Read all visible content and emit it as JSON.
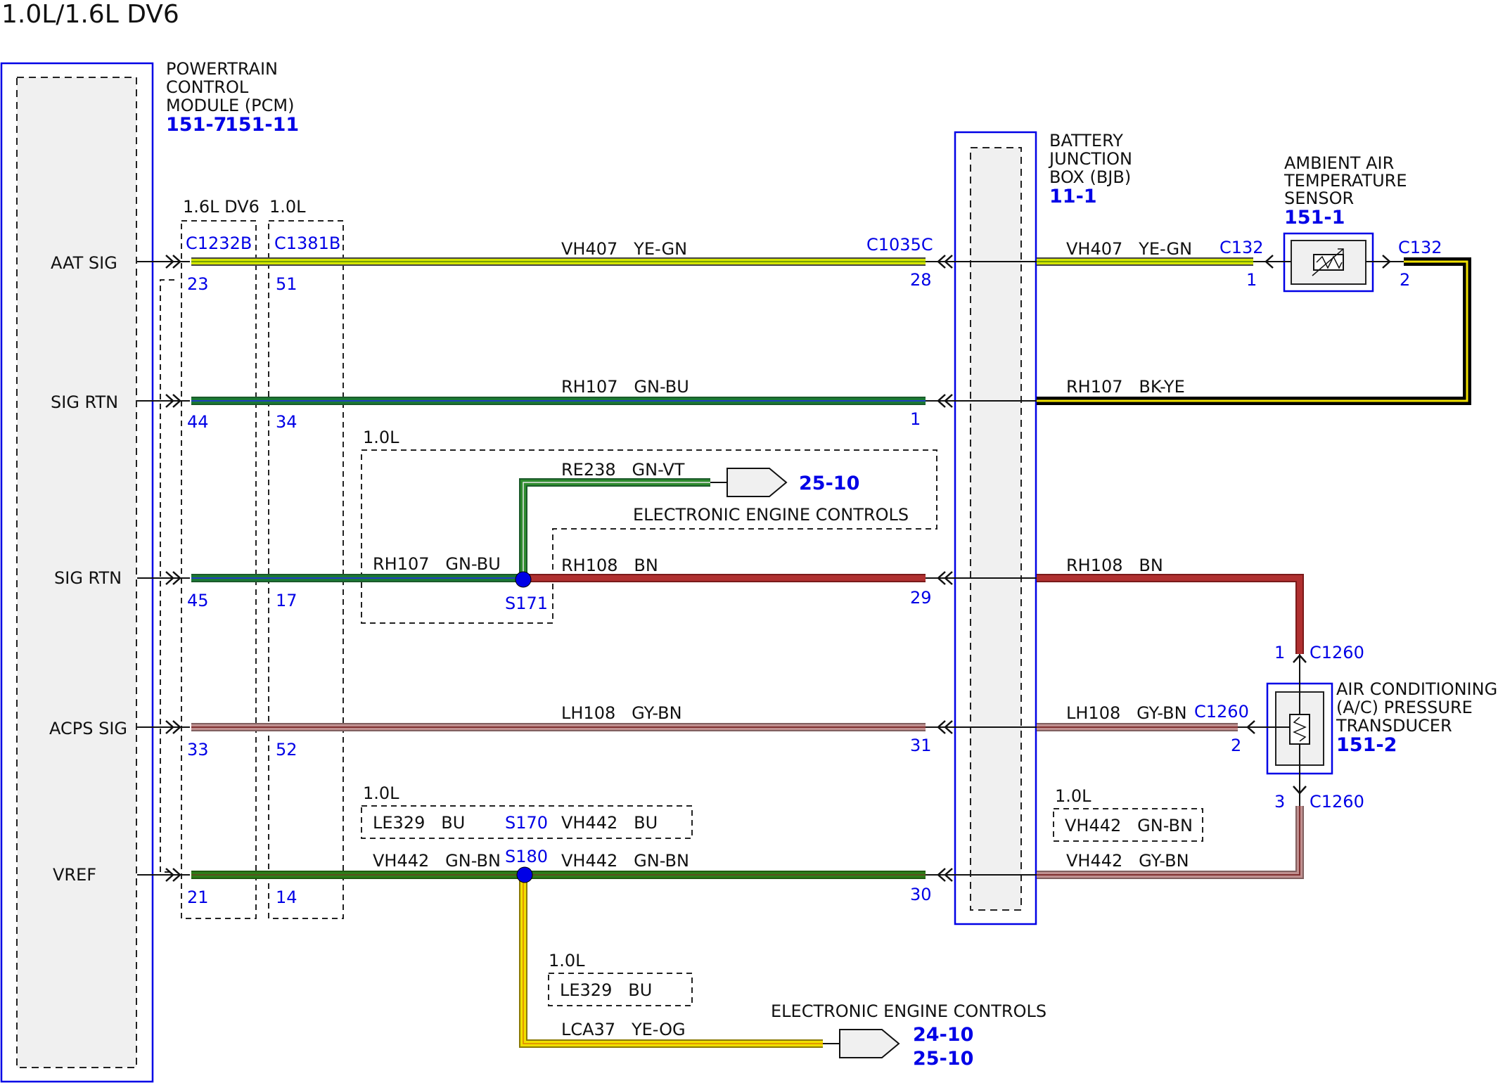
{
  "diagram_title": "1.0L/1.6L DV6",
  "pcm": {
    "name_lines": [
      "POWERTRAIN",
      "CONTROL",
      "MODULE (PCM)"
    ],
    "refs": [
      "151-7",
      "151-11"
    ],
    "pins": [
      "AAT SIG",
      "SIG RTN",
      "SIG RTN",
      "ACPS SIG",
      "VREF"
    ]
  },
  "connectors": {
    "c1232b": {
      "label": "C1232B",
      "variant": "1.6L DV6",
      "pins": [
        "23",
        "44",
        "45",
        "33",
        "21"
      ]
    },
    "c1381b": {
      "label": "C1381B",
      "variant": "1.0L",
      "pins": [
        "51",
        "34",
        "17",
        "52",
        "14"
      ]
    },
    "c1035c": {
      "label": "C1035C",
      "pins": [
        "28",
        "1",
        "29",
        "31",
        "30"
      ]
    }
  },
  "bjb": {
    "name_lines": [
      "BATTERY",
      "JUNCTION",
      "BOX (BJB)"
    ],
    "ref": "11-1"
  },
  "aat_sensor": {
    "name_lines": [
      "AMBIENT AIR",
      "TEMPERATURE",
      "SENSOR"
    ],
    "ref": "151-1",
    "connector": "C132",
    "pin_left": "1",
    "pin_right": "2"
  },
  "ac_transducer": {
    "name_lines": [
      "AIR CONDITIONING",
      "(A/C) PRESSURE",
      "TRANSDUCER"
    ],
    "ref": "151-2",
    "connector": "C1260",
    "pin_top": "1",
    "pin_mid": "2",
    "pin_bottom": "3"
  },
  "wires": {
    "w1_left": "VH407   YE-GN",
    "w1_right": "VH407   YE-GN",
    "w2_left": "RH107   GN-BU",
    "w2_right": "RH107   BK-YE",
    "w3_pcm": "RH107   GN-BU",
    "w3_branch": "RE238   GN-VT",
    "w3_mid": "RH108   BN",
    "w3_right": "RH108   BN",
    "w4_left": "LH108   GY-BN",
    "w4_right": "LH108   GY-BN",
    "w5_left": "VH442   GN-BN",
    "w5_mid": "VH442   GN-BN",
    "w5_right": "VH442   GY-BN",
    "w5_down": "LCA37   YE-OG"
  },
  "splices": {
    "s171": "S171",
    "s180": "S180",
    "s170": "S170"
  },
  "options": {
    "opt_1": "1.0L",
    "opt_2": "1.0L",
    "opt_2_le": "LE329   BU",
    "opt_2_vh": "VH442   BU",
    "opt_3": "1.0L",
    "opt_3_vh": "VH442   GN-BN",
    "opt_4": "1.0L",
    "opt_4_le": "LE329   BU"
  },
  "destinations": {
    "eec_1": {
      "label": "ELECTRONIC ENGINE CONTROLS",
      "ref": "25-10"
    },
    "eec_2": {
      "label": "ELECTRONIC ENGINE CONTROLS",
      "refs": [
        "24-10",
        "25-10"
      ]
    }
  },
  "colors": {
    "YE-GN": "#d4e600",
    "GN-BU": "#1a7a34",
    "BK-YE": "#000000",
    "GN-VT": "#2e8b2e",
    "BN": "#b03030",
    "GY-BN": "#b08080",
    "GN-BN": "#2e7d18",
    "YE-OG": "#f0e000",
    "module-border": "#0000e6",
    "module-fill": "#f0f0f0"
  }
}
